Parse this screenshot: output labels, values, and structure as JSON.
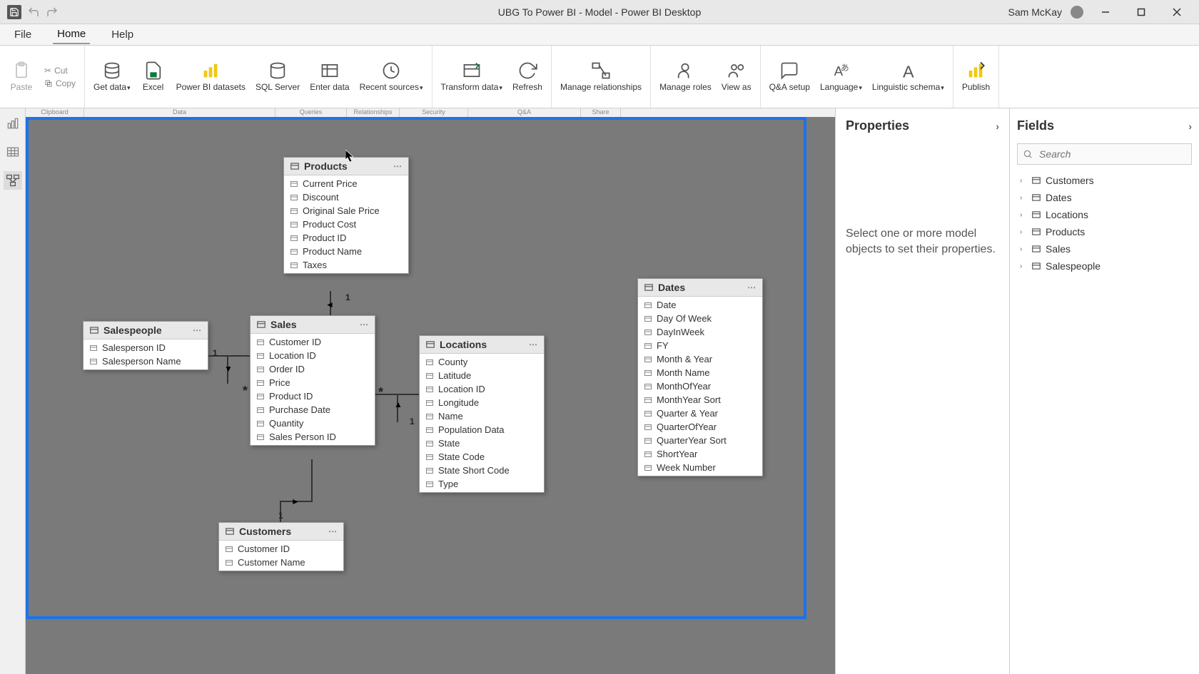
{
  "titlebar": {
    "title": "UBG To Power BI - Model - Power BI Desktop",
    "user": "Sam McKay"
  },
  "menubar": {
    "file": "File",
    "home": "Home",
    "help": "Help"
  },
  "ribbon": {
    "clipboard": {
      "paste": "Paste",
      "cut": "Cut",
      "copy": "Copy"
    },
    "data": {
      "get_data": "Get data",
      "excel": "Excel",
      "pbi_datasets": "Power BI datasets",
      "sql_server": "SQL Server",
      "enter_data": "Enter data",
      "recent_sources": "Recent sources"
    },
    "queries": {
      "transform": "Transform data",
      "refresh": "Refresh"
    },
    "relationships": {
      "manage": "Manage relationships"
    },
    "security": {
      "manage_roles": "Manage roles",
      "view_as": "View as"
    },
    "qna": {
      "qna_setup": "Q&A setup",
      "language": "Language",
      "linguistic": "Linguistic schema"
    },
    "share": {
      "publish": "Publish"
    },
    "group_labels": {
      "clipboard": "Clipboard",
      "data": "Data",
      "queries": "Queries",
      "relationships": "Relationships",
      "security": "Security",
      "qna": "Q&A",
      "share": "Share"
    }
  },
  "properties": {
    "title": "Properties",
    "help_text": "Select one or more model objects to set their properties."
  },
  "fields": {
    "title": "Fields",
    "search_placeholder": "Search",
    "items": [
      {
        "label": "Customers"
      },
      {
        "label": "Dates"
      },
      {
        "label": "Locations"
      },
      {
        "label": "Products"
      },
      {
        "label": "Sales"
      },
      {
        "label": "Salespeople"
      }
    ]
  },
  "tables": {
    "products": {
      "name": "Products",
      "fields": [
        "Current Price",
        "Discount",
        "Original Sale Price",
        "Product Cost",
        "Product ID",
        "Product Name",
        "Taxes"
      ]
    },
    "salespeople": {
      "name": "Salespeople",
      "fields": [
        "Salesperson ID",
        "Salesperson Name"
      ]
    },
    "sales": {
      "name": "Sales",
      "fields": [
        "Customer ID",
        "Location ID",
        "Order ID",
        "Price",
        "Product ID",
        "Purchase Date",
        "Quantity",
        "Sales Person ID"
      ]
    },
    "locations": {
      "name": "Locations",
      "fields": [
        "County",
        "Latitude",
        "Location ID",
        "Longitude",
        "Name",
        "Population Data",
        "State",
        "State Code",
        "State Short Code",
        "Type"
      ]
    },
    "dates": {
      "name": "Dates",
      "fields": [
        "Date",
        "Day Of Week",
        "DayInWeek",
        "FY",
        "Month & Year",
        "Month Name",
        "MonthOfYear",
        "MonthYear Sort",
        "Quarter & Year",
        "QuarterOfYear",
        "QuarterYear Sort",
        "ShortYear",
        "Week Number"
      ]
    },
    "customers": {
      "name": "Customers",
      "fields": [
        "Customer ID",
        "Customer Name"
      ]
    }
  },
  "relationship_markers": {
    "one": "1",
    "many": "*"
  }
}
